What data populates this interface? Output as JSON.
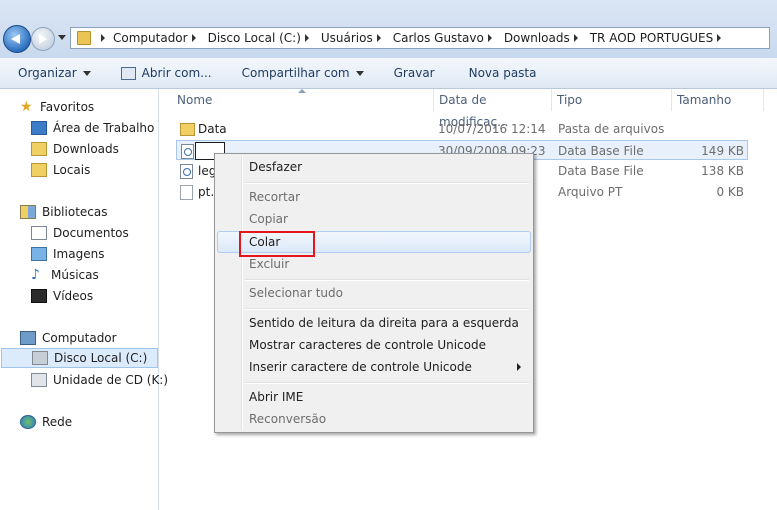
{
  "breadcrumbs": [
    "Computador",
    "Disco Local (C:)",
    "Usuários",
    "Carlos Gustavo",
    "Downloads",
    "TR AOD PORTUGUES"
  ],
  "toolbar": {
    "organize": "Organizar",
    "open_with": "Abrir com...",
    "share_with": "Compartilhar com",
    "burn": "Gravar",
    "new_folder": "Nova pasta"
  },
  "nav": {
    "favorites": "Favoritos",
    "desktop": "Área de Trabalho",
    "downloads": "Downloads",
    "places": "Locais",
    "libraries": "Bibliotecas",
    "documents": "Documentos",
    "images": "Imagens",
    "music": "Músicas",
    "videos": "Vídeos",
    "computer": "Computador",
    "local_disk": "Disco Local (C:)",
    "cd_drive": "Unidade de CD (K:)",
    "network": "Rede"
  },
  "columns": {
    "name": "Nome",
    "date": "Data de modificaç...",
    "type": "Tipo",
    "size": "Tamanho"
  },
  "files": [
    {
      "name": "Data",
      "date": "10/07/2016 12:14",
      "type": "Pasta de arquivos",
      "size": ""
    },
    {
      "name": "",
      "date": "30/09/2008 09:23",
      "type": "Data Base File",
      "size": "149 KB"
    },
    {
      "name": "leg",
      "date": "",
      "type": "Data Base File",
      "size": "138 KB"
    },
    {
      "name": "pt.p",
      "date": "",
      "type": "Arquivo PT",
      "size": "0 KB"
    }
  ],
  "context_menu": {
    "undo": "Desfazer",
    "cut": "Recortar",
    "copy": "Copiar",
    "paste": "Colar",
    "delete": "Excluir",
    "select_all": "Selecionar tudo",
    "rtl": "Sentido de leitura da direita para a esquerda",
    "show_unicode": "Mostrar caracteres de controle Unicode",
    "insert_unicode": "Inserir caractere de controle Unicode",
    "open_ime": "Abrir IME",
    "reconversion": "Reconversão"
  },
  "colors": {
    "highlight_box": "#e4161c",
    "selection": "#dcebfc"
  }
}
